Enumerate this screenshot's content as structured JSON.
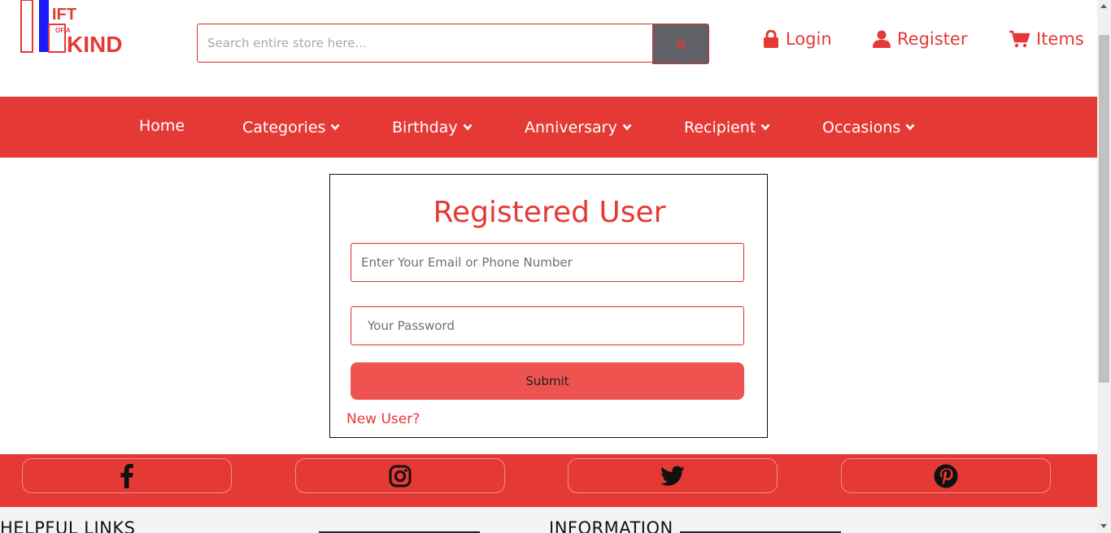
{
  "header": {
    "logo": {
      "text_top": "IFT",
      "text_mid": "OF A",
      "text_bottom": "KIND"
    },
    "search": {
      "placeholder": "Search entire store here...",
      "button_icon": "search-icon"
    },
    "links": [
      {
        "label": "Login",
        "icon": "lock-icon"
      },
      {
        "label": "Register",
        "icon": "user-icon"
      },
      {
        "label": "Items",
        "icon": "cart-icon"
      }
    ]
  },
  "nav": {
    "items": [
      {
        "label": "Home",
        "has_dropdown": false
      },
      {
        "label": "Categories",
        "has_dropdown": true
      },
      {
        "label": "Birthday",
        "has_dropdown": true
      },
      {
        "label": "Anniversary",
        "has_dropdown": true
      },
      {
        "label": "Recipient",
        "has_dropdown": true
      },
      {
        "label": "Occasions",
        "has_dropdown": true
      }
    ]
  },
  "login": {
    "title": "Registered User",
    "email_placeholder": "Enter Your Email or Phone Number",
    "password_placeholder": "Your Password",
    "submit_label": "Submit",
    "new_user_label": "New User?"
  },
  "social": [
    "facebook-icon",
    "instagram-icon",
    "twitter-icon",
    "pinterest-icon"
  ],
  "footer": {
    "headings": [
      "HELPFUL LINKS",
      "INFORMATION"
    ]
  },
  "colors": {
    "brand_red": "#e53935",
    "button_red": "#ef5350",
    "search_button": "#5f6166",
    "logo_blue": "#1a1aff"
  }
}
